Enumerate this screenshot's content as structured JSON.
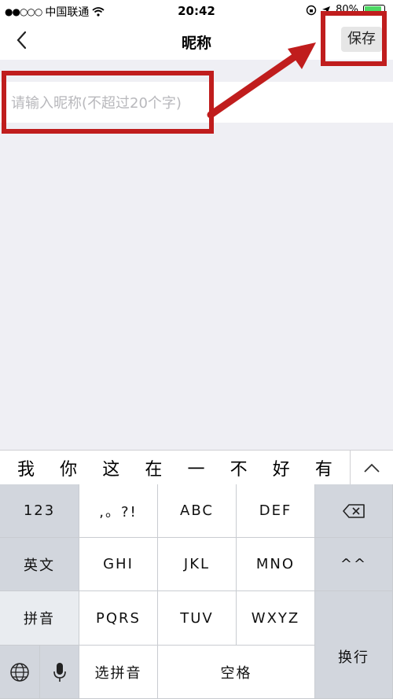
{
  "status_bar": {
    "carrier": "中国联通",
    "time": "20:42",
    "battery": "80%"
  },
  "nav": {
    "title": "昵称",
    "save_label": "保存"
  },
  "input": {
    "placeholder": "请输入昵称(不超过20个字)",
    "value": ""
  },
  "suggestions": [
    "我",
    "你",
    "这",
    "在",
    "一",
    "不",
    "好",
    "有"
  ],
  "keyboard": {
    "key_123": "123",
    "key_punct": ",。?!",
    "key_abc": "ABC",
    "key_def": "DEF",
    "key_english": "英文",
    "key_ghi": "GHI",
    "key_jkl": "JKL",
    "key_mno": "MNO",
    "key_emoticon": "^^",
    "key_pinyin": "拼音",
    "key_pqrs": "PQRS",
    "key_tuv": "TUV",
    "key_wxyz": "WXYZ",
    "key_return": "换行",
    "key_select_pinyin": "选拼音",
    "key_space": "空格"
  },
  "colors": {
    "annotation": "#c01d1d",
    "battery": "#4cd964"
  }
}
